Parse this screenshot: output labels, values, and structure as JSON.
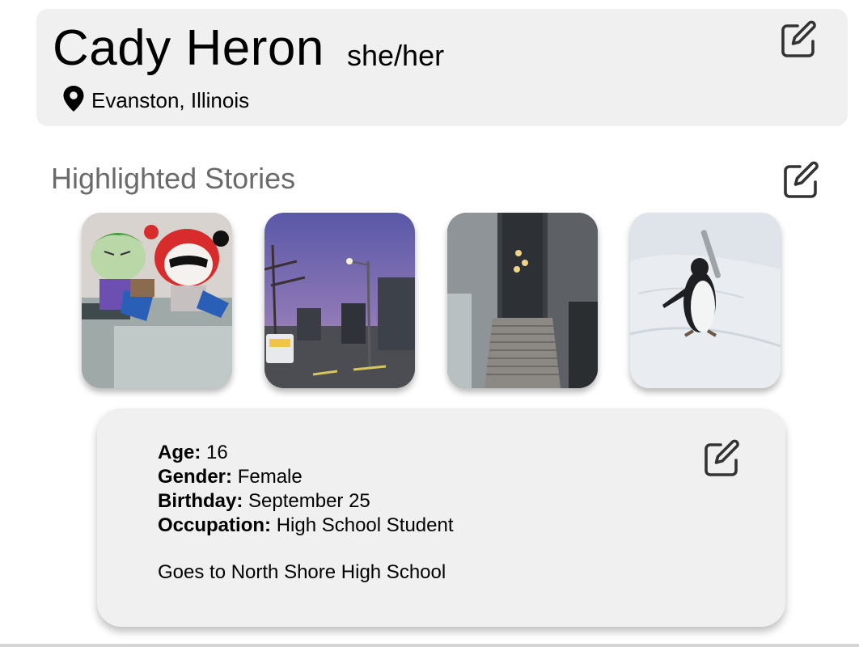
{
  "profile": {
    "name": "Cady Heron",
    "pronouns": "she/her",
    "location": "Evanston, Illinois",
    "location_icon": "map-pin-icon",
    "edit_icon": "edit-icon"
  },
  "stories": {
    "title": "Highlighted Stories",
    "items": [
      {
        "subject": "plush toys"
      },
      {
        "subject": "street at dusk"
      },
      {
        "subject": "outdoor staircase"
      },
      {
        "subject": "penguin on snow"
      }
    ]
  },
  "details": {
    "age_label": "Age:",
    "age_value": "16",
    "gender_label": "Gender:",
    "gender_value": "Female",
    "birthday_label": "Birthday:",
    "birthday_value": "September 25",
    "occupation_label": "Occupation:",
    "occupation_value": "High School Student",
    "note": "Goes to North Shore High School"
  },
  "colors": {
    "card_bg": "#f0f0f0",
    "muted_heading": "#6a6a6a",
    "icon": "#333333"
  }
}
